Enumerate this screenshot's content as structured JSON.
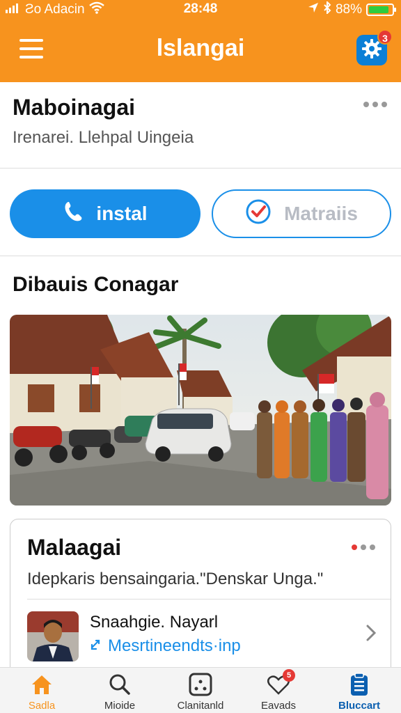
{
  "status_bar": {
    "carrier": "Ƨo Adacin",
    "time": "28:48",
    "battery_percent": "88%",
    "battery_level": 0.88
  },
  "app_bar": {
    "title": "lslangai",
    "notification_count": "3"
  },
  "profile": {
    "name": "Maboinagai",
    "subtitle": "Irenarei. Llehpal Uingeia"
  },
  "actions": {
    "install_label": "instal",
    "secondary_label": "Matraiis"
  },
  "section": {
    "title": "Dibauis Conagar"
  },
  "card": {
    "title": "Malaagai",
    "description": "Idepkaris bensaingaria.\"Denskar Unga.\"",
    "user_name": "Snaahgie. Nayarl",
    "user_link": "Mesrtineendts·inp"
  },
  "bottom_nav": {
    "items": [
      {
        "label": "Sadla",
        "icon": "home-icon"
      },
      {
        "label": "Mioide",
        "icon": "search-icon"
      },
      {
        "label": "Clanitanld",
        "icon": "dice-icon"
      },
      {
        "label": "Eavads",
        "icon": "heart-icon",
        "badge": "5"
      },
      {
        "label": "Bluccart",
        "icon": "clipboard-icon"
      }
    ]
  },
  "colors": {
    "accent_orange": "#f7931e",
    "primary_blue": "#1a8fe8",
    "badge_red": "#e53935"
  }
}
